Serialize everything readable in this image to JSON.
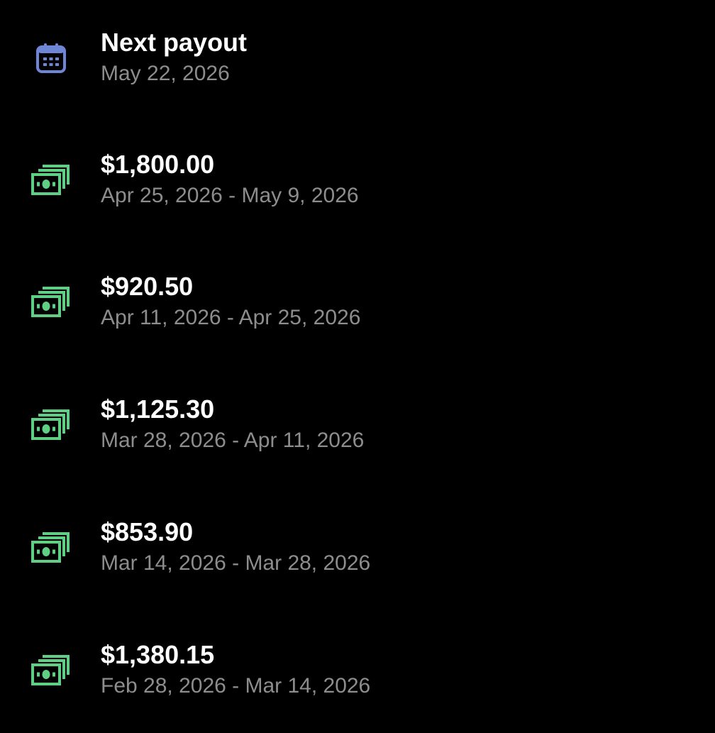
{
  "next_payout": {
    "title": "Next payout",
    "date": "May 22, 2026",
    "icon": "calendar-icon",
    "icon_color": "#6f86d6"
  },
  "payouts": [
    {
      "amount": "$1,800.00",
      "period": "Apr 25, 2026 - May 9, 2026",
      "icon": "money-stack-icon"
    },
    {
      "amount": "$920.50",
      "period": "Apr 11, 2026 - Apr 25, 2026",
      "icon": "money-stack-icon"
    },
    {
      "amount": "$1,125.30",
      "period": "Mar 28, 2026 - Apr 11, 2026",
      "icon": "money-stack-icon"
    },
    {
      "amount": "$853.90",
      "period": "Mar 14, 2026 - Mar 28, 2026",
      "icon": "money-stack-icon"
    },
    {
      "amount": "$1,380.15",
      "period": "Feb 28, 2026 - Mar 14, 2026",
      "icon": "money-stack-icon"
    }
  ],
  "colors": {
    "background": "#000000",
    "title": "#ffffff",
    "subtitle": "#8d8d8d",
    "money_icon": "#5fcf86",
    "calendar_icon": "#6f86d6"
  }
}
